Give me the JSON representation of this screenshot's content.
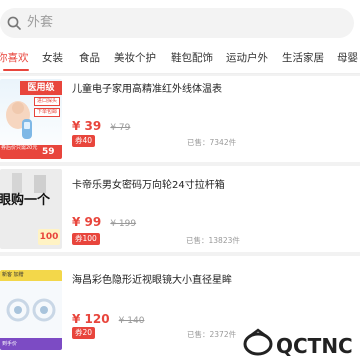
{
  "search": {
    "placeholder": "外套"
  },
  "tabs": [
    "你喜欢",
    "女装",
    "食品",
    "美妆个护",
    "鞋包配饰",
    "运动户外",
    "生活家居",
    "母婴"
  ],
  "products": [
    {
      "title": "儿童电子家用高精准红外线体温表",
      "price": "¥ 39",
      "original_price": "¥ 79",
      "coupon": "券40",
      "sold": "已售：7342件",
      "thumb": {
        "badge": "医用级",
        "tags": [
          "进口探头",
          "下单包邮"
        ],
        "bar_text": "券后价只需20元",
        "price": "59"
      }
    },
    {
      "title": "卡帝乐男女密码万向轮24寸拉杆箱",
      "price": "¥ 99",
      "original_price": "¥ 199",
      "coupon": "券100",
      "sold": "已售：13823件",
      "thumb": {
        "text": "眼购一个",
        "price": "100"
      }
    },
    {
      "title": "海昌彩色隐形近视眼镜大小直径星眸",
      "price": "¥ 120",
      "original_price": "¥ 140",
      "coupon": "券20",
      "sold": "已售：2372件",
      "thumb": {
        "top_text": "新客 加赠",
        "bottom_text": "到手价"
      }
    }
  ],
  "watermark": {
    "text": "QCTNC"
  },
  "colors": {
    "accent": "#e8453c",
    "text": "#222222",
    "muted": "#999999"
  }
}
